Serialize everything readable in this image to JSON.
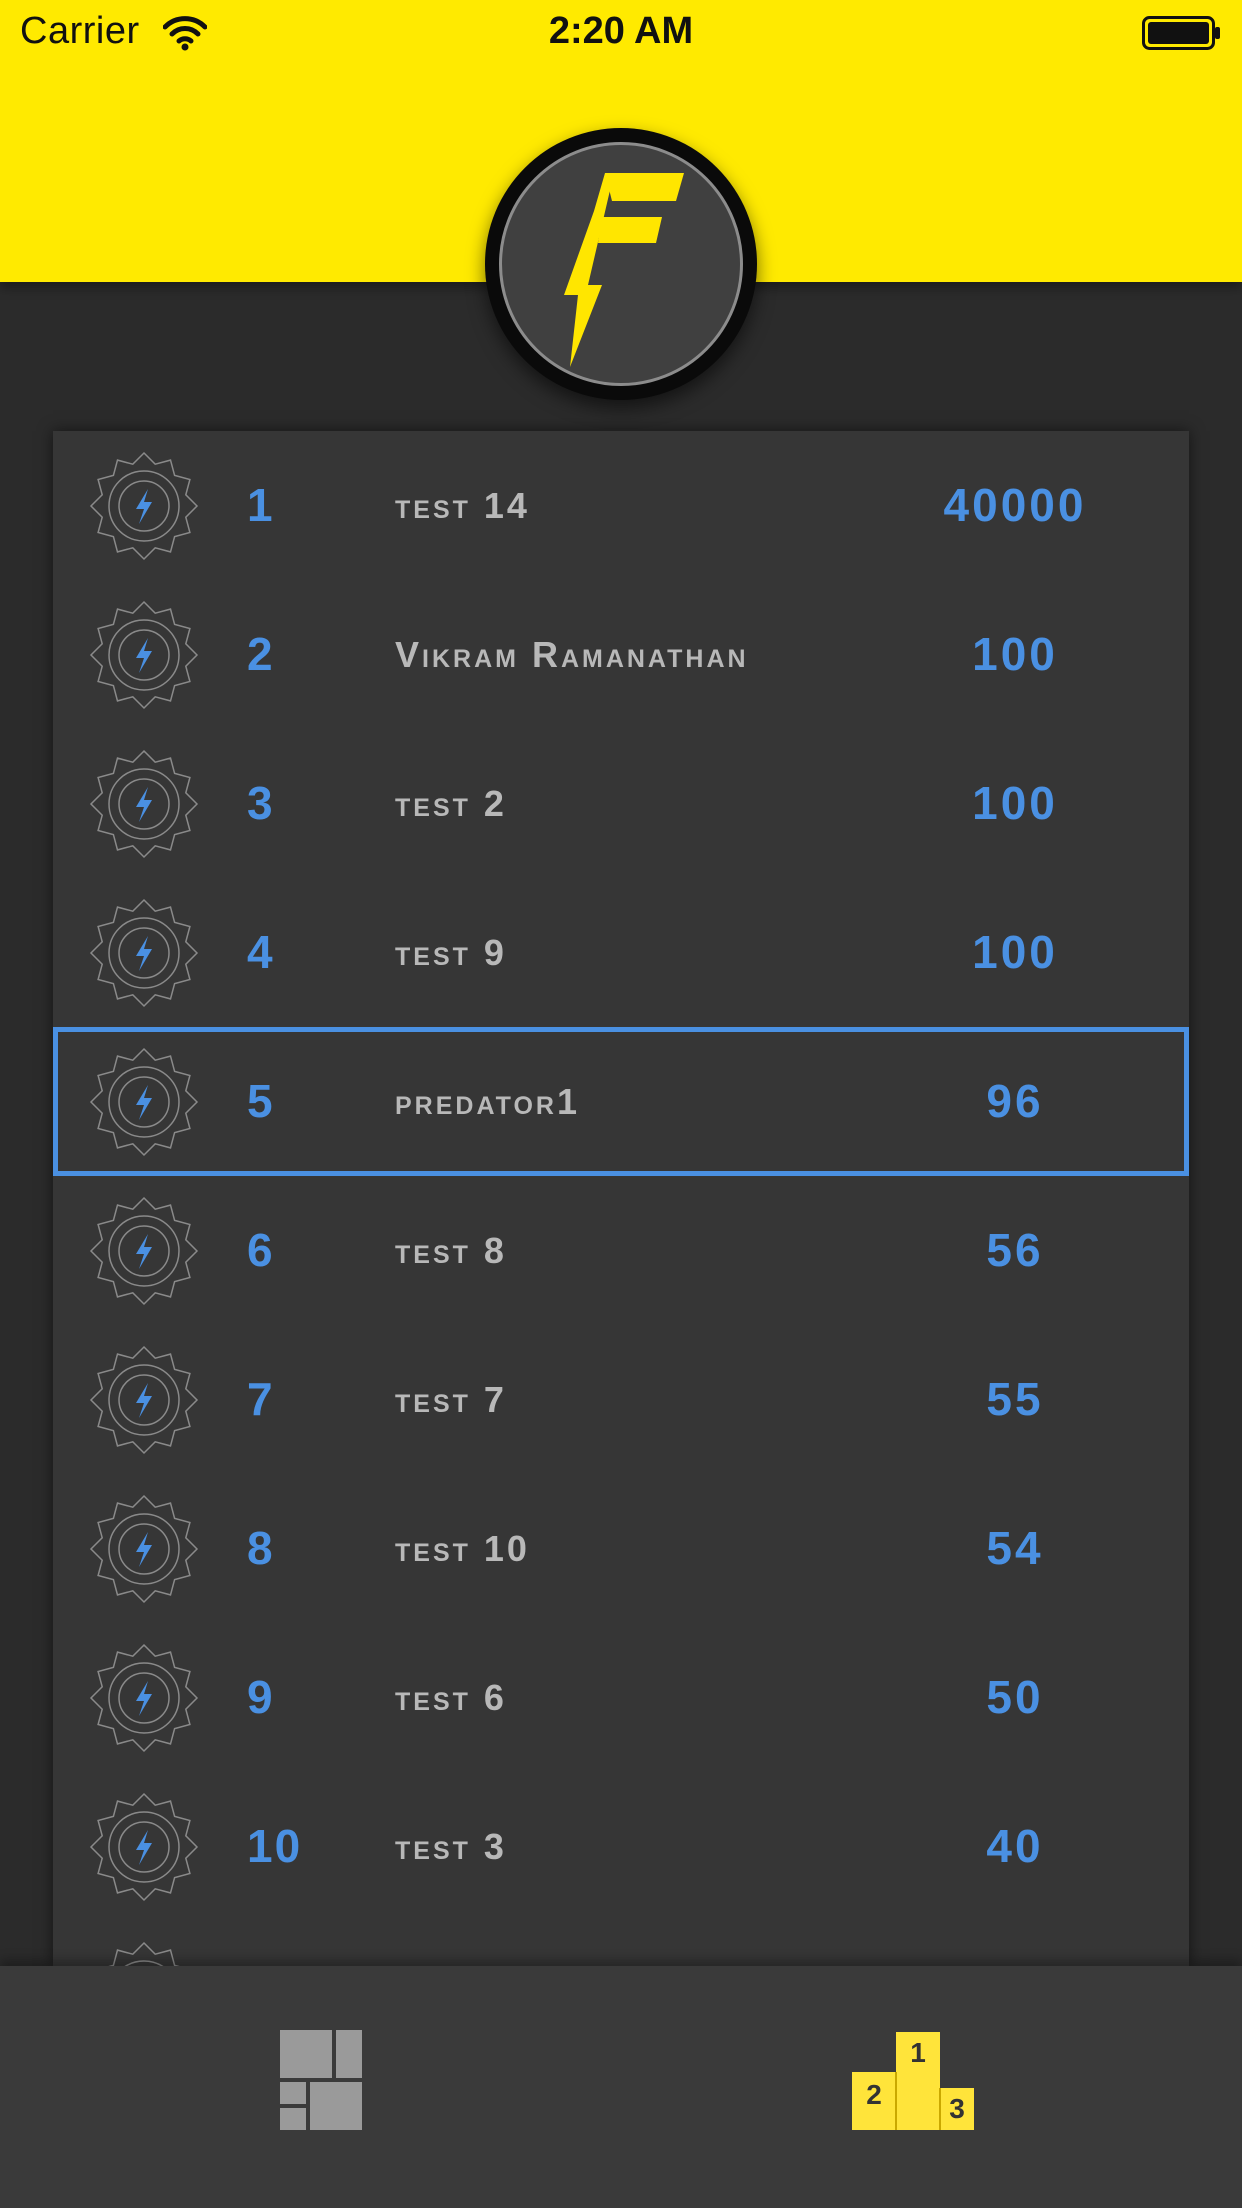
{
  "status_bar": {
    "carrier": "Carrier",
    "time": "2:20 AM"
  },
  "logo": {
    "letter": "F",
    "icon": "lightning-f-logo-icon"
  },
  "leaderboard": {
    "rows": [
      {
        "rank": "1",
        "name": "test 14",
        "score": "40000"
      },
      {
        "rank": "2",
        "name": "Vikram Ramanathan",
        "score": "100"
      },
      {
        "rank": "3",
        "name": "test 2",
        "score": "100"
      },
      {
        "rank": "4",
        "name": "test 9",
        "score": "100"
      },
      {
        "rank": "5",
        "name": "predator1",
        "score": "96"
      },
      {
        "rank": "6",
        "name": "test 8",
        "score": "56"
      },
      {
        "rank": "7",
        "name": "test 7",
        "score": "55"
      },
      {
        "rank": "8",
        "name": "test 10",
        "score": "54"
      },
      {
        "rank": "9",
        "name": "test 6",
        "score": "50"
      },
      {
        "rank": "10",
        "name": "test 3",
        "score": "40"
      }
    ],
    "highlighted_rank": "5"
  },
  "tab_bar": {
    "dashboard_icon": "dashboard-tiles-icon",
    "leaderboard_icon": "podium-icon",
    "podium_labels": [
      "1",
      "2",
      "3"
    ]
  },
  "colors": {
    "header": "#ffea00",
    "accent": "#4a90e2",
    "background": "#2b2b2b",
    "card": "#363636"
  }
}
